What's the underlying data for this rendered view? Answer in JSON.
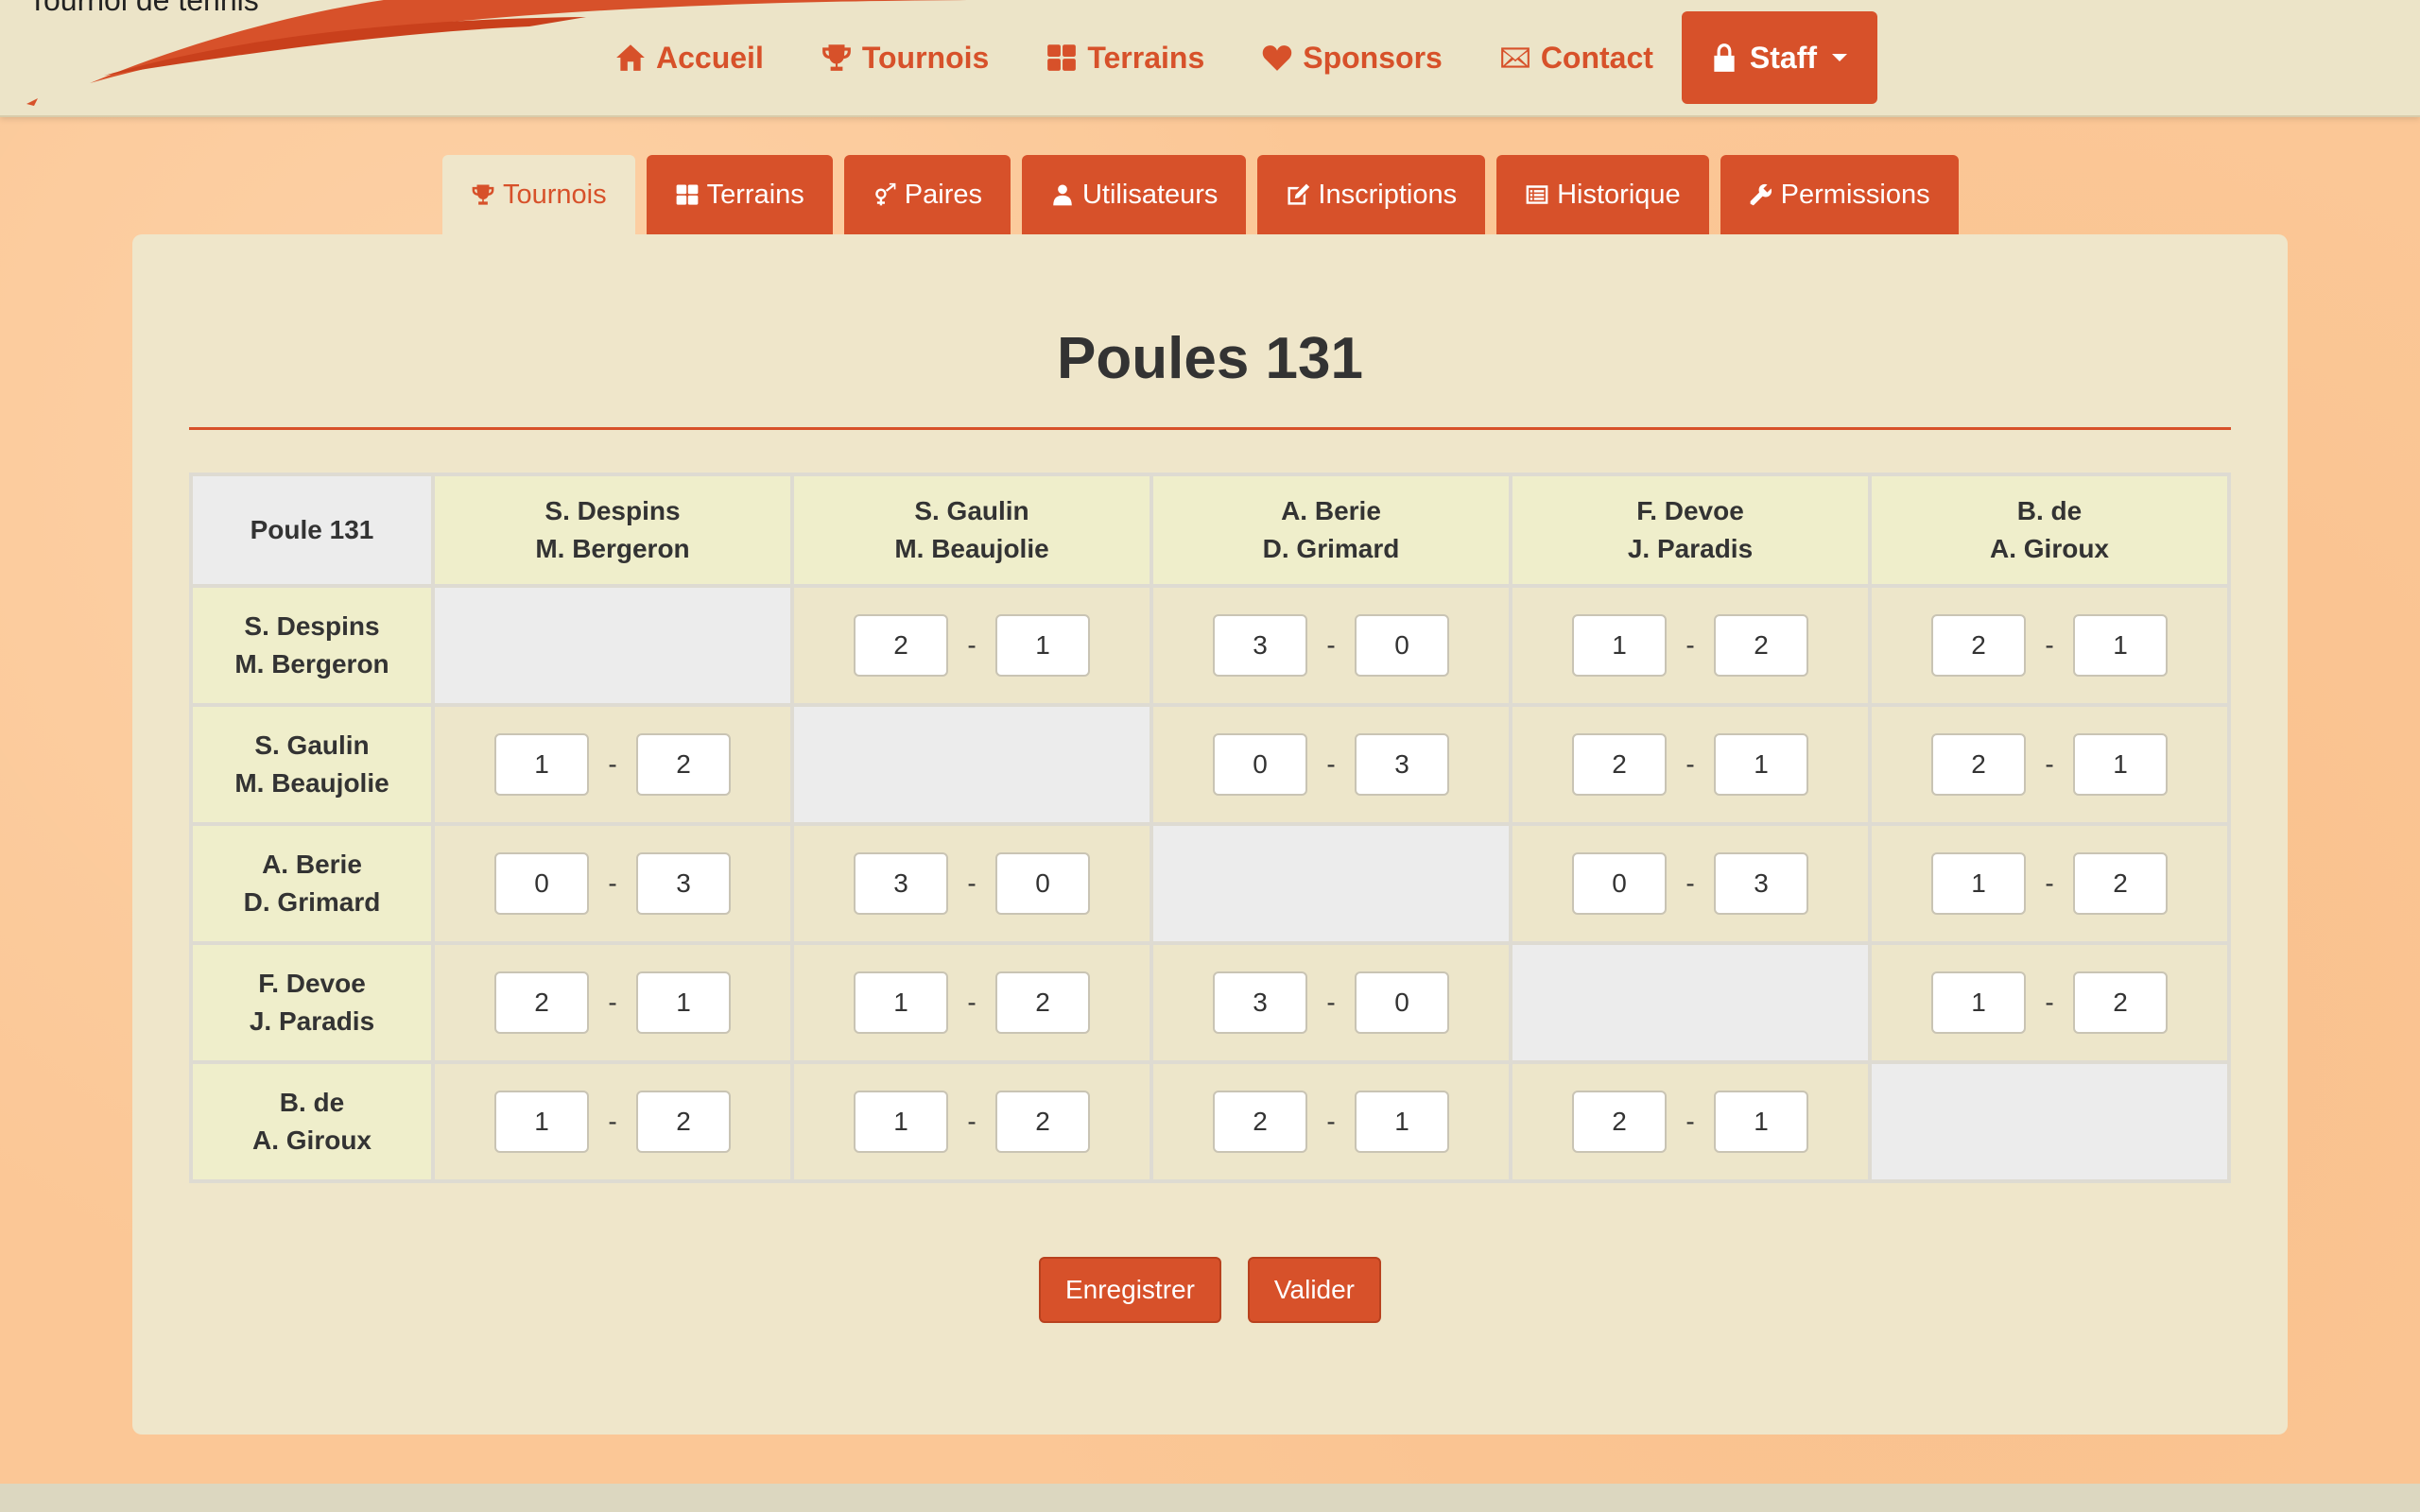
{
  "brand": {
    "text": "Tournoi de tennis"
  },
  "nav": {
    "items": [
      {
        "label": "Accueil",
        "icon": "home-icon"
      },
      {
        "label": "Tournois",
        "icon": "trophy-icon"
      },
      {
        "label": "Terrains",
        "icon": "grid-icon"
      },
      {
        "label": "Sponsors",
        "icon": "heart-icon"
      },
      {
        "label": "Contact",
        "icon": "envelope-icon"
      }
    ],
    "staff": {
      "label": "Staff",
      "icon": "lock-icon"
    }
  },
  "tabs": [
    {
      "label": "Tournois",
      "icon": "trophy-icon",
      "active": true
    },
    {
      "label": "Terrains",
      "icon": "grid-icon"
    },
    {
      "label": "Paires",
      "icon": "gender-icon"
    },
    {
      "label": "Utilisateurs",
      "icon": "user-icon"
    },
    {
      "label": "Inscriptions",
      "icon": "edit-icon"
    },
    {
      "label": "Historique",
      "icon": "list-icon"
    },
    {
      "label": "Permissions",
      "icon": "wrench-icon"
    }
  ],
  "panel": {
    "title": "Poules 131",
    "corner_label": "Poule 131",
    "pairs": [
      {
        "line1": "S. Despins",
        "line2": "M. Bergeron"
      },
      {
        "line1": "S. Gaulin",
        "line2": "M. Beaujolie"
      },
      {
        "line1": "A. Berie",
        "line2": "D. Grimard"
      },
      {
        "line1": "F. Devoe",
        "line2": "J. Paradis"
      },
      {
        "line1": "B. de",
        "line2": "A. Giroux"
      }
    ],
    "scores": [
      [
        null,
        [
          "2",
          "1"
        ],
        [
          "3",
          "0"
        ],
        [
          "1",
          "2"
        ],
        [
          "2",
          "1"
        ]
      ],
      [
        [
          "1",
          "2"
        ],
        null,
        [
          "0",
          "3"
        ],
        [
          "2",
          "1"
        ],
        [
          "2",
          "1"
        ]
      ],
      [
        [
          "0",
          "3"
        ],
        [
          "3",
          "0"
        ],
        null,
        [
          "0",
          "3"
        ],
        [
          "1",
          "2"
        ]
      ],
      [
        [
          "2",
          "1"
        ],
        [
          "1",
          "2"
        ],
        [
          "3",
          "0"
        ],
        null,
        [
          "1",
          "2"
        ]
      ],
      [
        [
          "1",
          "2"
        ],
        [
          "1",
          "2"
        ],
        [
          "2",
          "1"
        ],
        [
          "2",
          "1"
        ],
        null
      ]
    ],
    "separator": "-",
    "buttons": {
      "save": "Enregistrer",
      "validate": "Valider"
    }
  },
  "colors": {
    "accent": "#d7512a",
    "panel": "#efe6ca",
    "background": "#fbc796"
  }
}
